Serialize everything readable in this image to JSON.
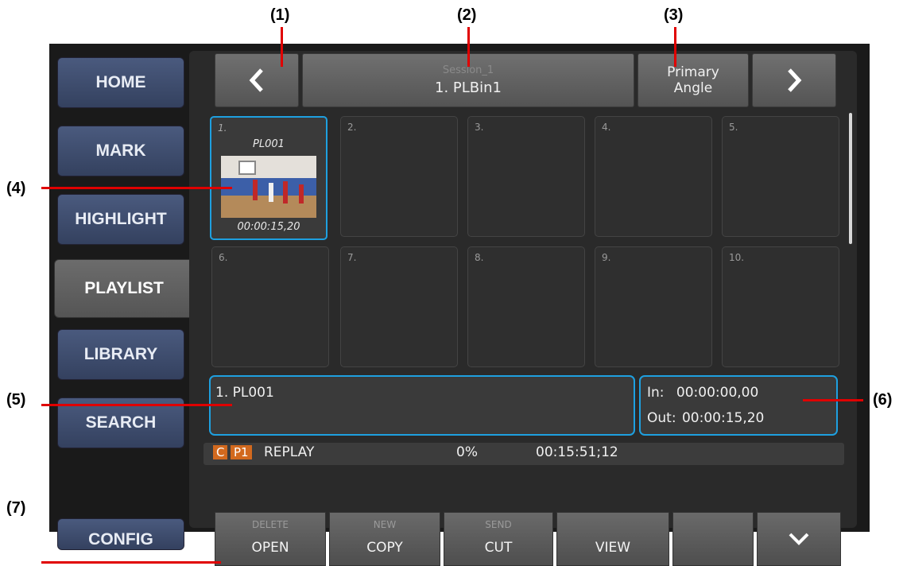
{
  "callouts": [
    "(1)",
    "(2)",
    "(3)",
    "(4)",
    "(5)",
    "(6)",
    "(7)"
  ],
  "sidebar": {
    "items": [
      {
        "label": "HOME"
      },
      {
        "label": "MARK"
      },
      {
        "label": "HIGHLIGHT"
      },
      {
        "label": "PLAYLIST",
        "active": true
      },
      {
        "label": "LIBRARY"
      },
      {
        "label": "SEARCH"
      },
      {
        "label": "CONFIG"
      }
    ]
  },
  "header": {
    "prev_icon": "chevron-left-icon",
    "session": "Session_1",
    "bin": "1. PLBin1",
    "angle_line1": "Primary",
    "angle_line2": "Angle",
    "next_icon": "chevron-right-icon"
  },
  "grid": {
    "cells": [
      {
        "num": "1.",
        "name": "PL001",
        "duration": "00:00:15,20",
        "selected": true
      },
      {
        "num": "2."
      },
      {
        "num": "3."
      },
      {
        "num": "4."
      },
      {
        "num": "5."
      },
      {
        "num": "6."
      },
      {
        "num": "7."
      },
      {
        "num": "8."
      },
      {
        "num": "9."
      },
      {
        "num": "10."
      }
    ]
  },
  "clip_name": "1. PL001",
  "inout": {
    "in_label": "In:",
    "in_value": "00:00:00,00",
    "out_label": "Out:",
    "out_value": "00:15,20"
  },
  "status": {
    "channel": "C",
    "player": "P1",
    "mode": "REPLAY",
    "percent": "0%",
    "timecode": "00:15:51;12"
  },
  "toolbar": [
    {
      "small": "DELETE",
      "main": "OPEN"
    },
    {
      "small": "NEW",
      "main": "COPY"
    },
    {
      "small": "SEND",
      "main": "CUT"
    },
    {
      "small": "",
      "main": "VIEW"
    },
    {
      "small": "",
      "main": ""
    }
  ],
  "colors": {
    "accent": "#1ea0e0",
    "status_badge": "#d2691e",
    "sidebar": "#3f4d6e"
  }
}
